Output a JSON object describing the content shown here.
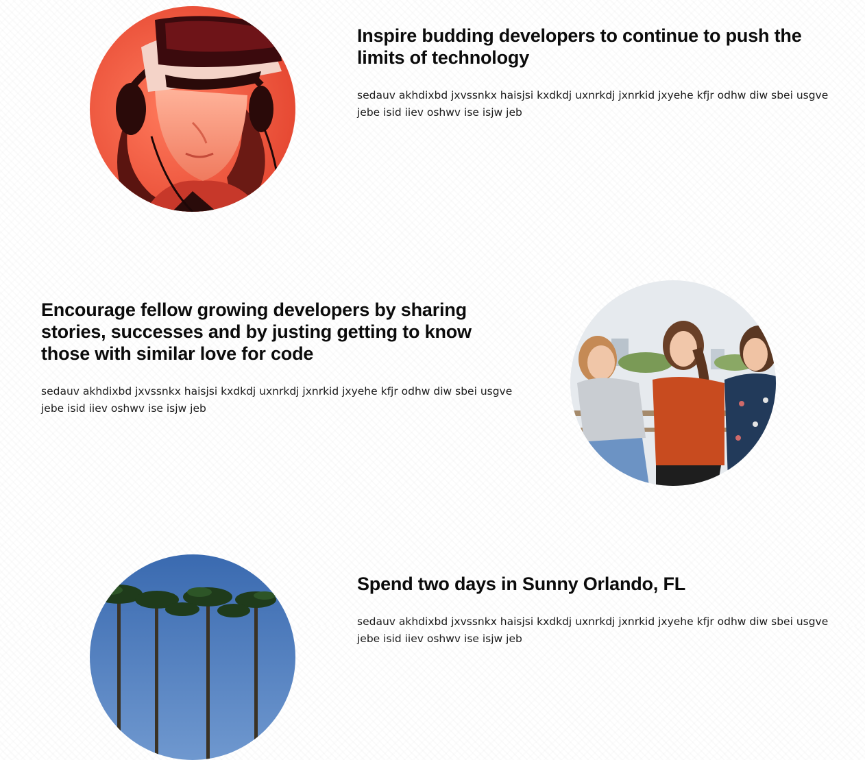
{
  "features": [
    {
      "heading": "Inspire budding developers to continue to push the limits of technology",
      "body": "sedauv akhdixbd jxvssnkx haisjsi kxdkdj uxnrkdj jxnrkid jxyehe kfjr odhw diw sbei usgve jebe isid iiev oshwv ise isjw jeb",
      "image": "vr-headset-photo"
    },
    {
      "heading": "Encourage fellow growing developers by sharing stories, successes and by justing getting to know those with similar love for code",
      "body": "sedauv akhdixbd jxvssnkx haisjsi kxdkdj uxnrkdj jxnrkid jxyehe kfjr odhw diw sbei usgve jebe isid iiev oshwv ise isjw jeb",
      "image": "friends-laughing-photo"
    },
    {
      "heading": "Spend two days in Sunny Orlando, FL",
      "body": "sedauv akhdixbd jxvssnkx haisjsi kxdkdj uxnrkdj jxnrkid jxyehe kfjr odhw diw sbei usgve jebe isid iiev oshwv ise isjw jeb",
      "image": "palm-trees-photo"
    }
  ],
  "colors": {
    "vr_bg": "#f0563f",
    "heading": "#0b0b0b",
    "sky": "#3f6fb0"
  }
}
